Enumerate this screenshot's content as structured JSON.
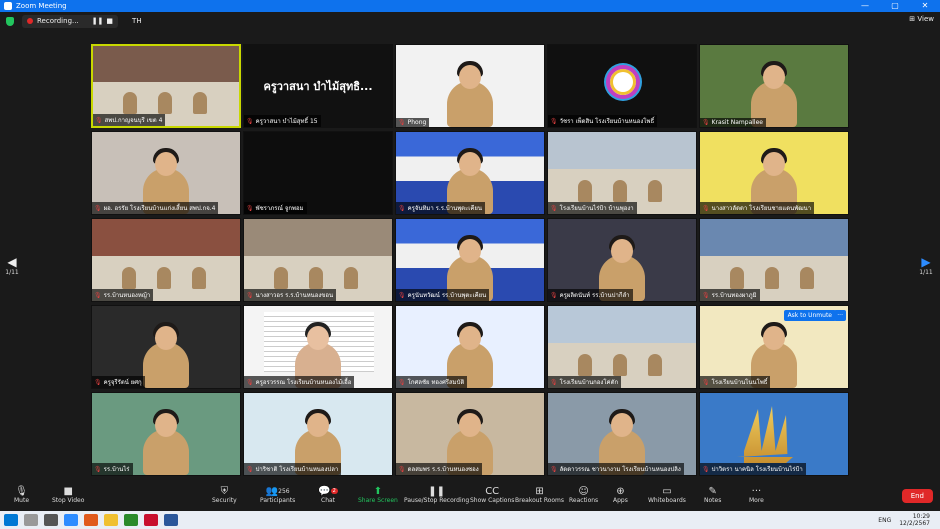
{
  "window": {
    "title": "Zoom Meeting",
    "minimize": "—",
    "maximize": "▢",
    "close": "✕"
  },
  "topbar": {
    "recording_label": "Recording...",
    "pause": "❚❚",
    "stop": "■",
    "language": "TH",
    "view_label": "View"
  },
  "pager": {
    "left": "1/11",
    "right": "1/11",
    "left_arrow": "◀",
    "right_arrow": "▶"
  },
  "tiles": [
    {
      "name": "สพป.กาญจนบุรี เขต 4",
      "bg": "#7a5b4c",
      "scene": "room-pink",
      "active": true
    },
    {
      "name": "ครูวาสนา บำไม้สุทธิ์ 15",
      "bg": "#111111",
      "scene": "name",
      "display_name": "ครูวาสนา บำไม้สุทธิ..."
    },
    {
      "name": "Phong",
      "bg": "#f2f2f2",
      "scene": "person-white"
    },
    {
      "name": "วัชรา เพ็ดสิน โรงเรียนบ้านหนองโพธิ์",
      "bg": "#101010",
      "scene": "logo"
    },
    {
      "name": "Krasit Nampallee",
      "bg": "#5a7a40",
      "scene": "person-outdoor"
    },
    {
      "name": "ผอ. อรรัย โรงเรียนบ้านแก่งเสี้ยน สพป.กจ.4",
      "bg": "#c8c0b8",
      "scene": "person-room"
    },
    {
      "name": "พัชราภรณ์ จูกพอม",
      "bg": "#0d0d0d",
      "scene": "blank"
    },
    {
      "name": "ครูจันทิมา ร.ร.บ้านพุตะเคียน",
      "bg": "#1f3fa8",
      "scene": "poster-person"
    },
    {
      "name": "โรงเรียนบ้านไร่ป้า บ้านพุองา",
      "bg": "#b8c4d0",
      "scene": "classroom"
    },
    {
      "name": "นางสาวลัดดา โรงเรียนชายแดนพัฒนา",
      "bg": "#f0e060",
      "scene": "person-yellow"
    },
    {
      "name": "รร.บ้านหนองหญ้า",
      "bg": "#8a5040",
      "scene": "room-red"
    },
    {
      "name": "นางสาวอร ร.ร.บ้านหนองขอน",
      "bg": "#9a8a78",
      "scene": "meeting-room"
    },
    {
      "name": "ครูนันทวัฒน์ รร.บ้านพุตะเคียน",
      "bg": "#1f3fa8",
      "scene": "poster-person"
    },
    {
      "name": "ครูผลิตนันท์ รร.บ้านปากีลำ",
      "bg": "#3a3a48",
      "scene": "person-dark"
    },
    {
      "name": "รร.บ้านทองผาภูมิ",
      "bg": "#6a88b0",
      "scene": "hall"
    },
    {
      "name": "ครูจุรีรัตน์ ยศกุ",
      "bg": "#2a2a2a",
      "scene": "person-door"
    },
    {
      "name": "ครูอรวรรณ โรงเรียนบ้านหนองไม้เอื้อ",
      "bg": "#f4f4f4",
      "scene": "document"
    },
    {
      "name": "โกศลชัย ทองศรีสมบัติ",
      "bg": "#e8f0ff",
      "scene": "person-glasses"
    },
    {
      "name": "โรงเรียนบ้านกองโค่ตัก",
      "bg": "#b8c8d8",
      "scene": "group"
    },
    {
      "name": "โรงเรียนบ้านโนนโพธิ์",
      "bg": "#f2e8c0",
      "scene": "person-right",
      "ask_unmute": "Ask to Unmute",
      "more": "···"
    },
    {
      "name": "รร.บ้านไร่",
      "bg": "#6a9a80",
      "scene": "person-green"
    },
    {
      "name": "ปาริชาติ โรงเรียนบ้านหนองปลา",
      "bg": "#d8e8f0",
      "scene": "person-close"
    },
    {
      "name": "ดลสมพร ร.ร.บ้านหนองซอง",
      "bg": "#c8b8a0",
      "scene": "person-shelf"
    },
    {
      "name": "ลัดดาวรรณ ชาวนางาม โรงเรียนบ้านหนองปลิง",
      "bg": "#8a9aa8",
      "scene": "person-tilt"
    },
    {
      "name": "ปาวิตรา นาคนิล โรงเรียนบ้านไร่ป้า",
      "bg": "#3a7ac8",
      "scene": "ship"
    }
  ],
  "toolbar": {
    "mute": "Mute",
    "stop_video": "Stop Video",
    "security": "Security",
    "participants": "Participants",
    "participants_count": "256",
    "chat": "Chat",
    "chat_badge": "2",
    "share_screen": "Share Screen",
    "pause_recording": "Pause/Stop Recording",
    "captions": "Show Captions",
    "breakout": "Breakout Rooms",
    "reactions": "Reactions",
    "apps": "Apps",
    "whiteboards": "Whiteboards",
    "notes": "Notes",
    "more": "More",
    "end": "End"
  },
  "tray": {
    "time": "10:29",
    "date": "12/2/2567",
    "lang": "ENG"
  }
}
